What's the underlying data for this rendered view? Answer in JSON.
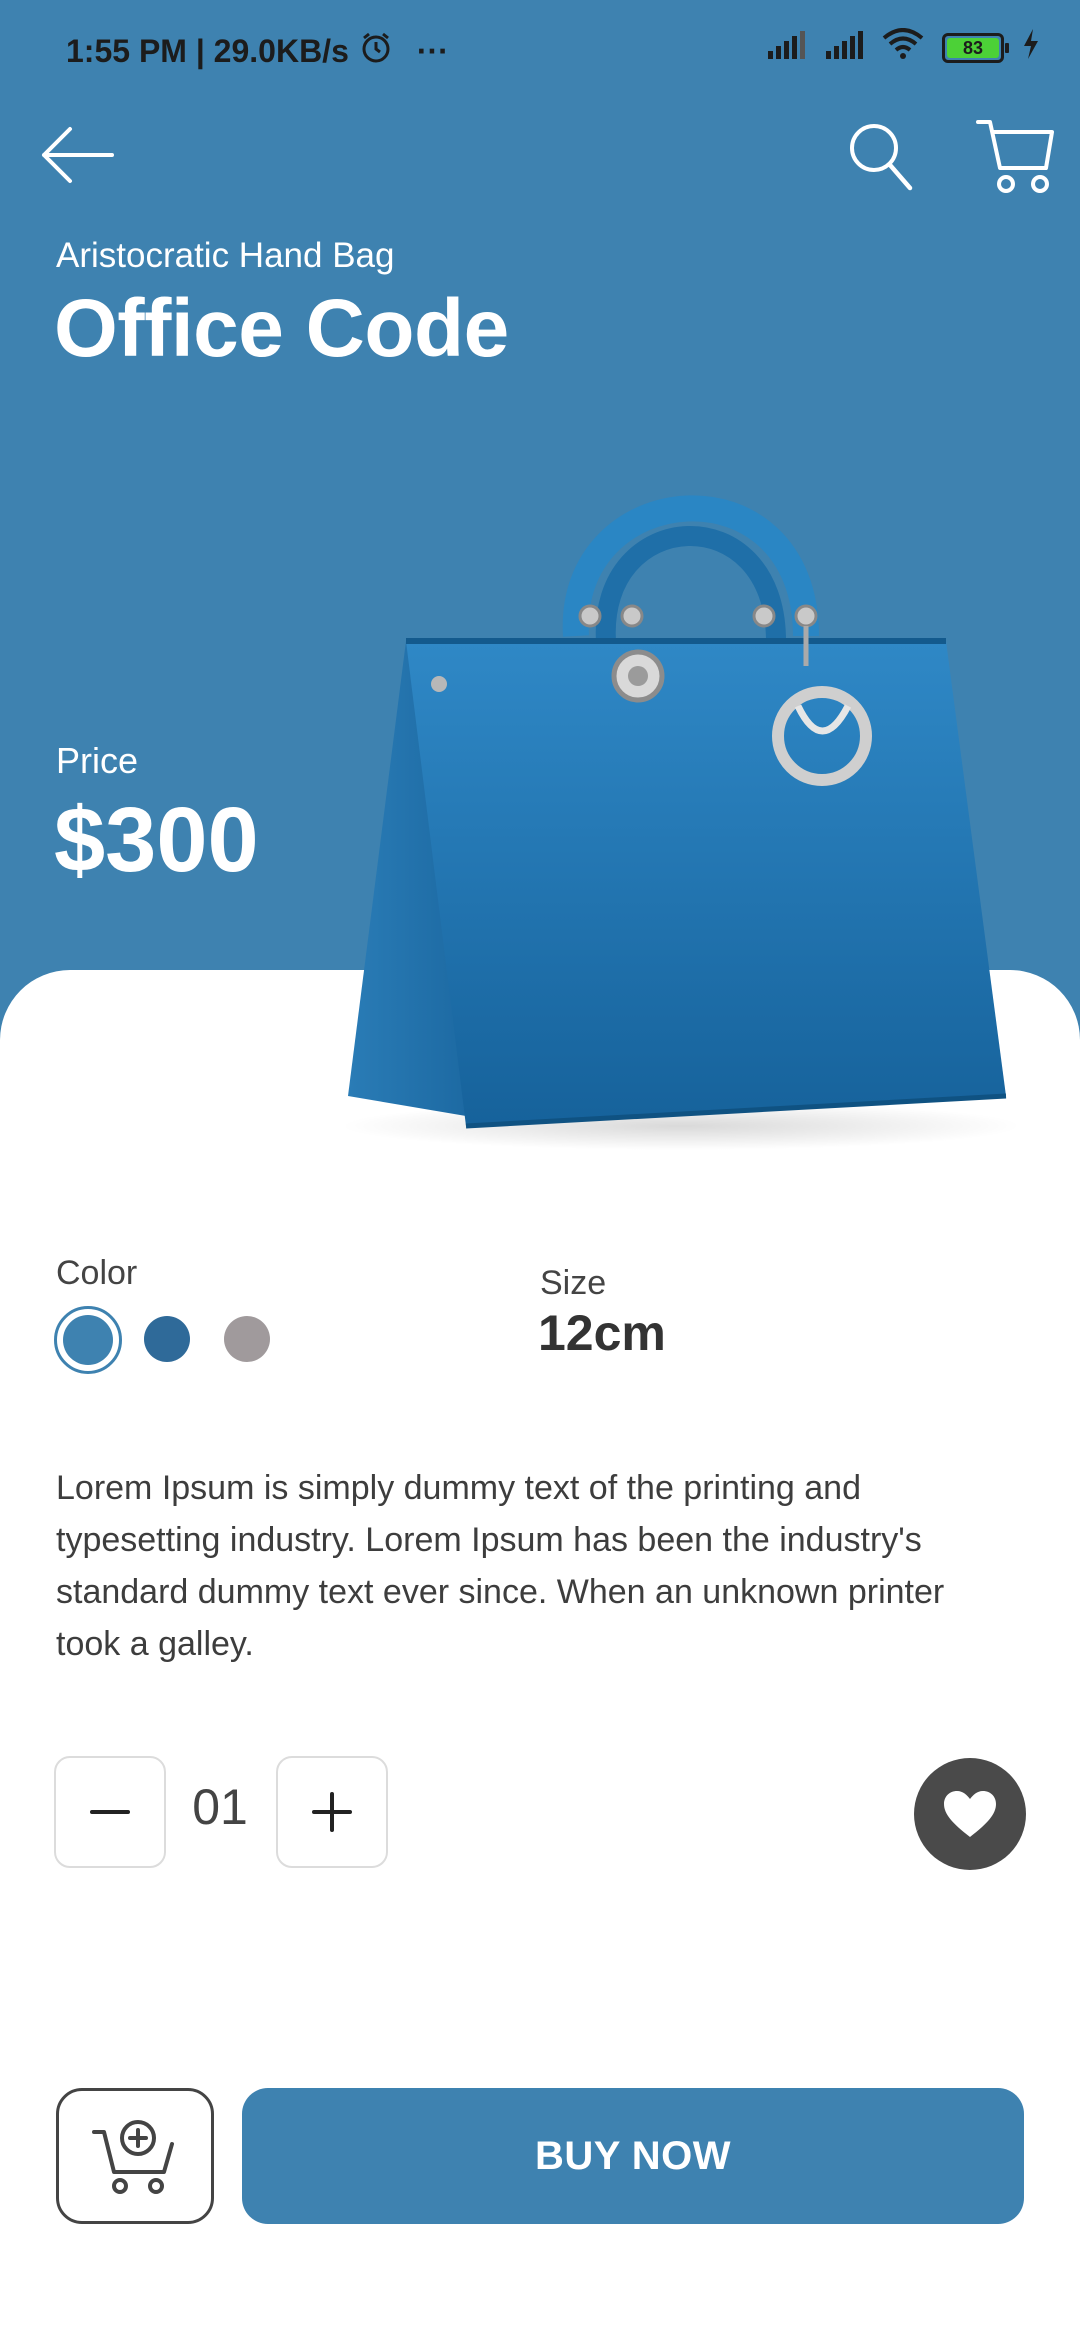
{
  "status_bar": {
    "time": "1:55 PM | 29.0KB/s",
    "alarm_icon": "alarm-icon",
    "more": "···",
    "battery": "83"
  },
  "nav": {
    "back_icon": "arrow-left-icon",
    "search_icon": "search-icon",
    "cart_icon": "cart-icon"
  },
  "product": {
    "subtitle": "Aristocratic Hand Bag",
    "title": "Office Code",
    "price_label": "Price",
    "price": "$300",
    "color_label": "Color",
    "colors": [
      "#3e82b0",
      "#2f6a99",
      "#a09a9c"
    ],
    "size_label": "Size",
    "size": "12cm",
    "description": "Lorem Ipsum is simply dummy text of the printing and typesetting industry. Lorem Ipsum has been the industry's standard dummy text ever since. When an unknown printer took a galley."
  },
  "quantity": {
    "value": "01"
  },
  "actions": {
    "buy_label": "BUY NOW",
    "add_to_cart_icon": "cart-plus-icon",
    "favorite_icon": "heart-icon"
  },
  "theme": {
    "accent": "#3e82b0"
  }
}
